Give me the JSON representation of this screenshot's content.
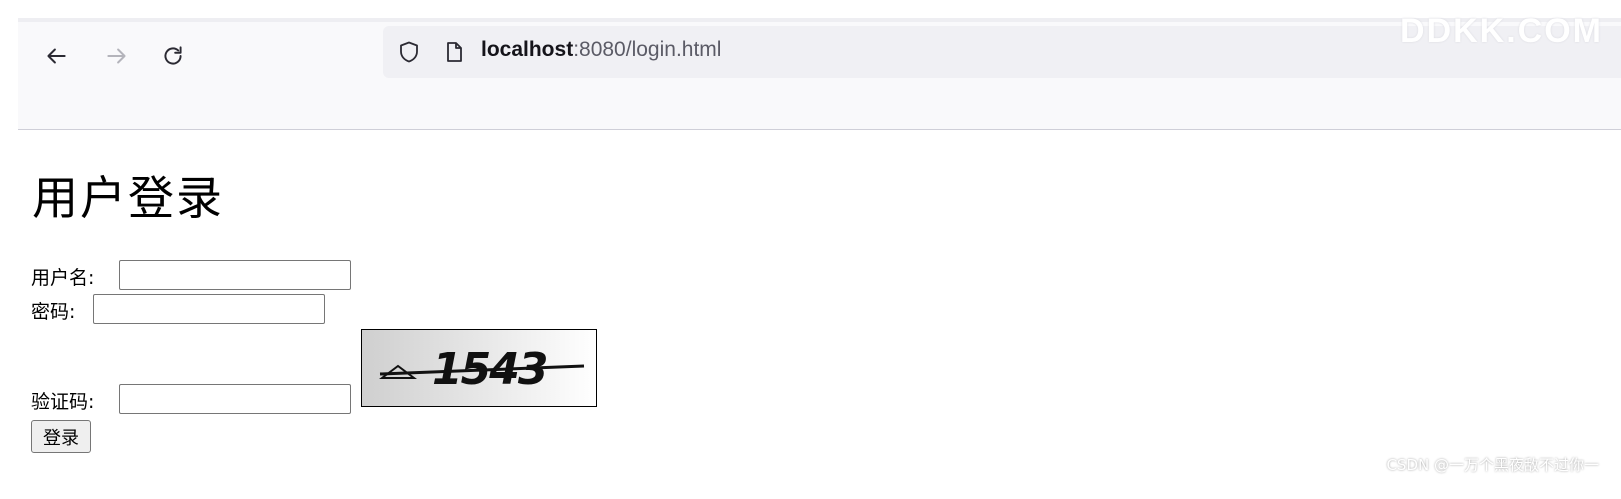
{
  "browser": {
    "url_host": "localhost",
    "url_rest": ":8080/login.html",
    "watermark": "DDKK.COM"
  },
  "page": {
    "title": "用户登录",
    "username_label": "用户名:",
    "password_label": "密码:",
    "captcha_label": "验证码:",
    "captcha_value": "1543",
    "login_button": "登录"
  },
  "footer_watermark": "CSDN @一万个黑夜敌不过你一"
}
